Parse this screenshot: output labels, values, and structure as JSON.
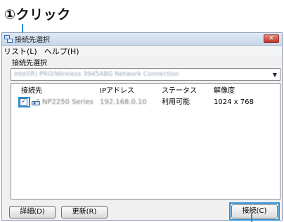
{
  "annotation": {
    "text": "①クリック"
  },
  "window": {
    "title": "接続先選択",
    "close_label": "✕"
  },
  "menu": {
    "items": [
      {
        "label": "リスト(L)"
      },
      {
        "label": "ヘルプ(H)"
      }
    ]
  },
  "connection": {
    "label": "接続先選択",
    "selected_adapter": "Intel(R) PRO/Wireless 3945ABG Network Connection"
  },
  "list": {
    "columns": [
      "接続先",
      "IPアドレス",
      "ステータス",
      "解像度"
    ],
    "rows": [
      {
        "checked": true,
        "check_glyph": "✓",
        "name": "NP2250 Series",
        "ip": "192.168.0.10",
        "status": "利用可能",
        "resolution": "1024 x 768"
      }
    ]
  },
  "buttons": {
    "details": "詳細(D)",
    "update": "更新(R)",
    "connect": "接続(C)"
  },
  "colors": {
    "highlight": "#2a8ed8"
  },
  "icons": {
    "app": "network-app-icon",
    "device": "projector-device-icon"
  }
}
